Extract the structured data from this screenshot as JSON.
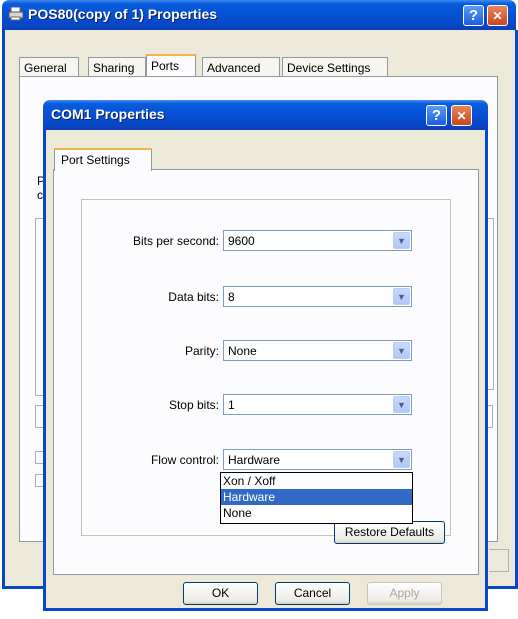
{
  "back_window": {
    "title": "POS80(copy of 1) Properties",
    "tabs": [
      "General",
      "Sharing",
      "Ports",
      "Advanced",
      "Device Settings"
    ],
    "active_tab": "Ports",
    "help_label": "?",
    "close_label": "✕"
  },
  "com_dialog": {
    "title": "COM1 Properties",
    "help_label": "?",
    "close_label": "✕",
    "tab": "Port Settings",
    "fields": {
      "bits_per_second": {
        "label": "Bits per second:",
        "value": "9600"
      },
      "data_bits": {
        "label": "Data bits:",
        "value": "8"
      },
      "parity": {
        "label": "Parity:",
        "value": "None"
      },
      "stop_bits": {
        "label": "Stop bits:",
        "value": "1"
      },
      "flow_control": {
        "label": "Flow control:",
        "value": "Hardware"
      }
    },
    "flow_control_options": [
      "Xon / Xoff",
      "Hardware",
      "None"
    ],
    "flow_control_highlighted": "Hardware",
    "restore_defaults_label": "Restore Defaults",
    "ok_label": "OK",
    "cancel_label": "Cancel",
    "apply_label": "Apply"
  },
  "back_window_fragments": {
    "letter_1": "P",
    "letter_2": "c"
  },
  "colors": {
    "titlebar": "#0551d6",
    "dialog_face": "#ece9d8",
    "selection": "#316ac5",
    "tab_highlight": "#f5b544"
  }
}
